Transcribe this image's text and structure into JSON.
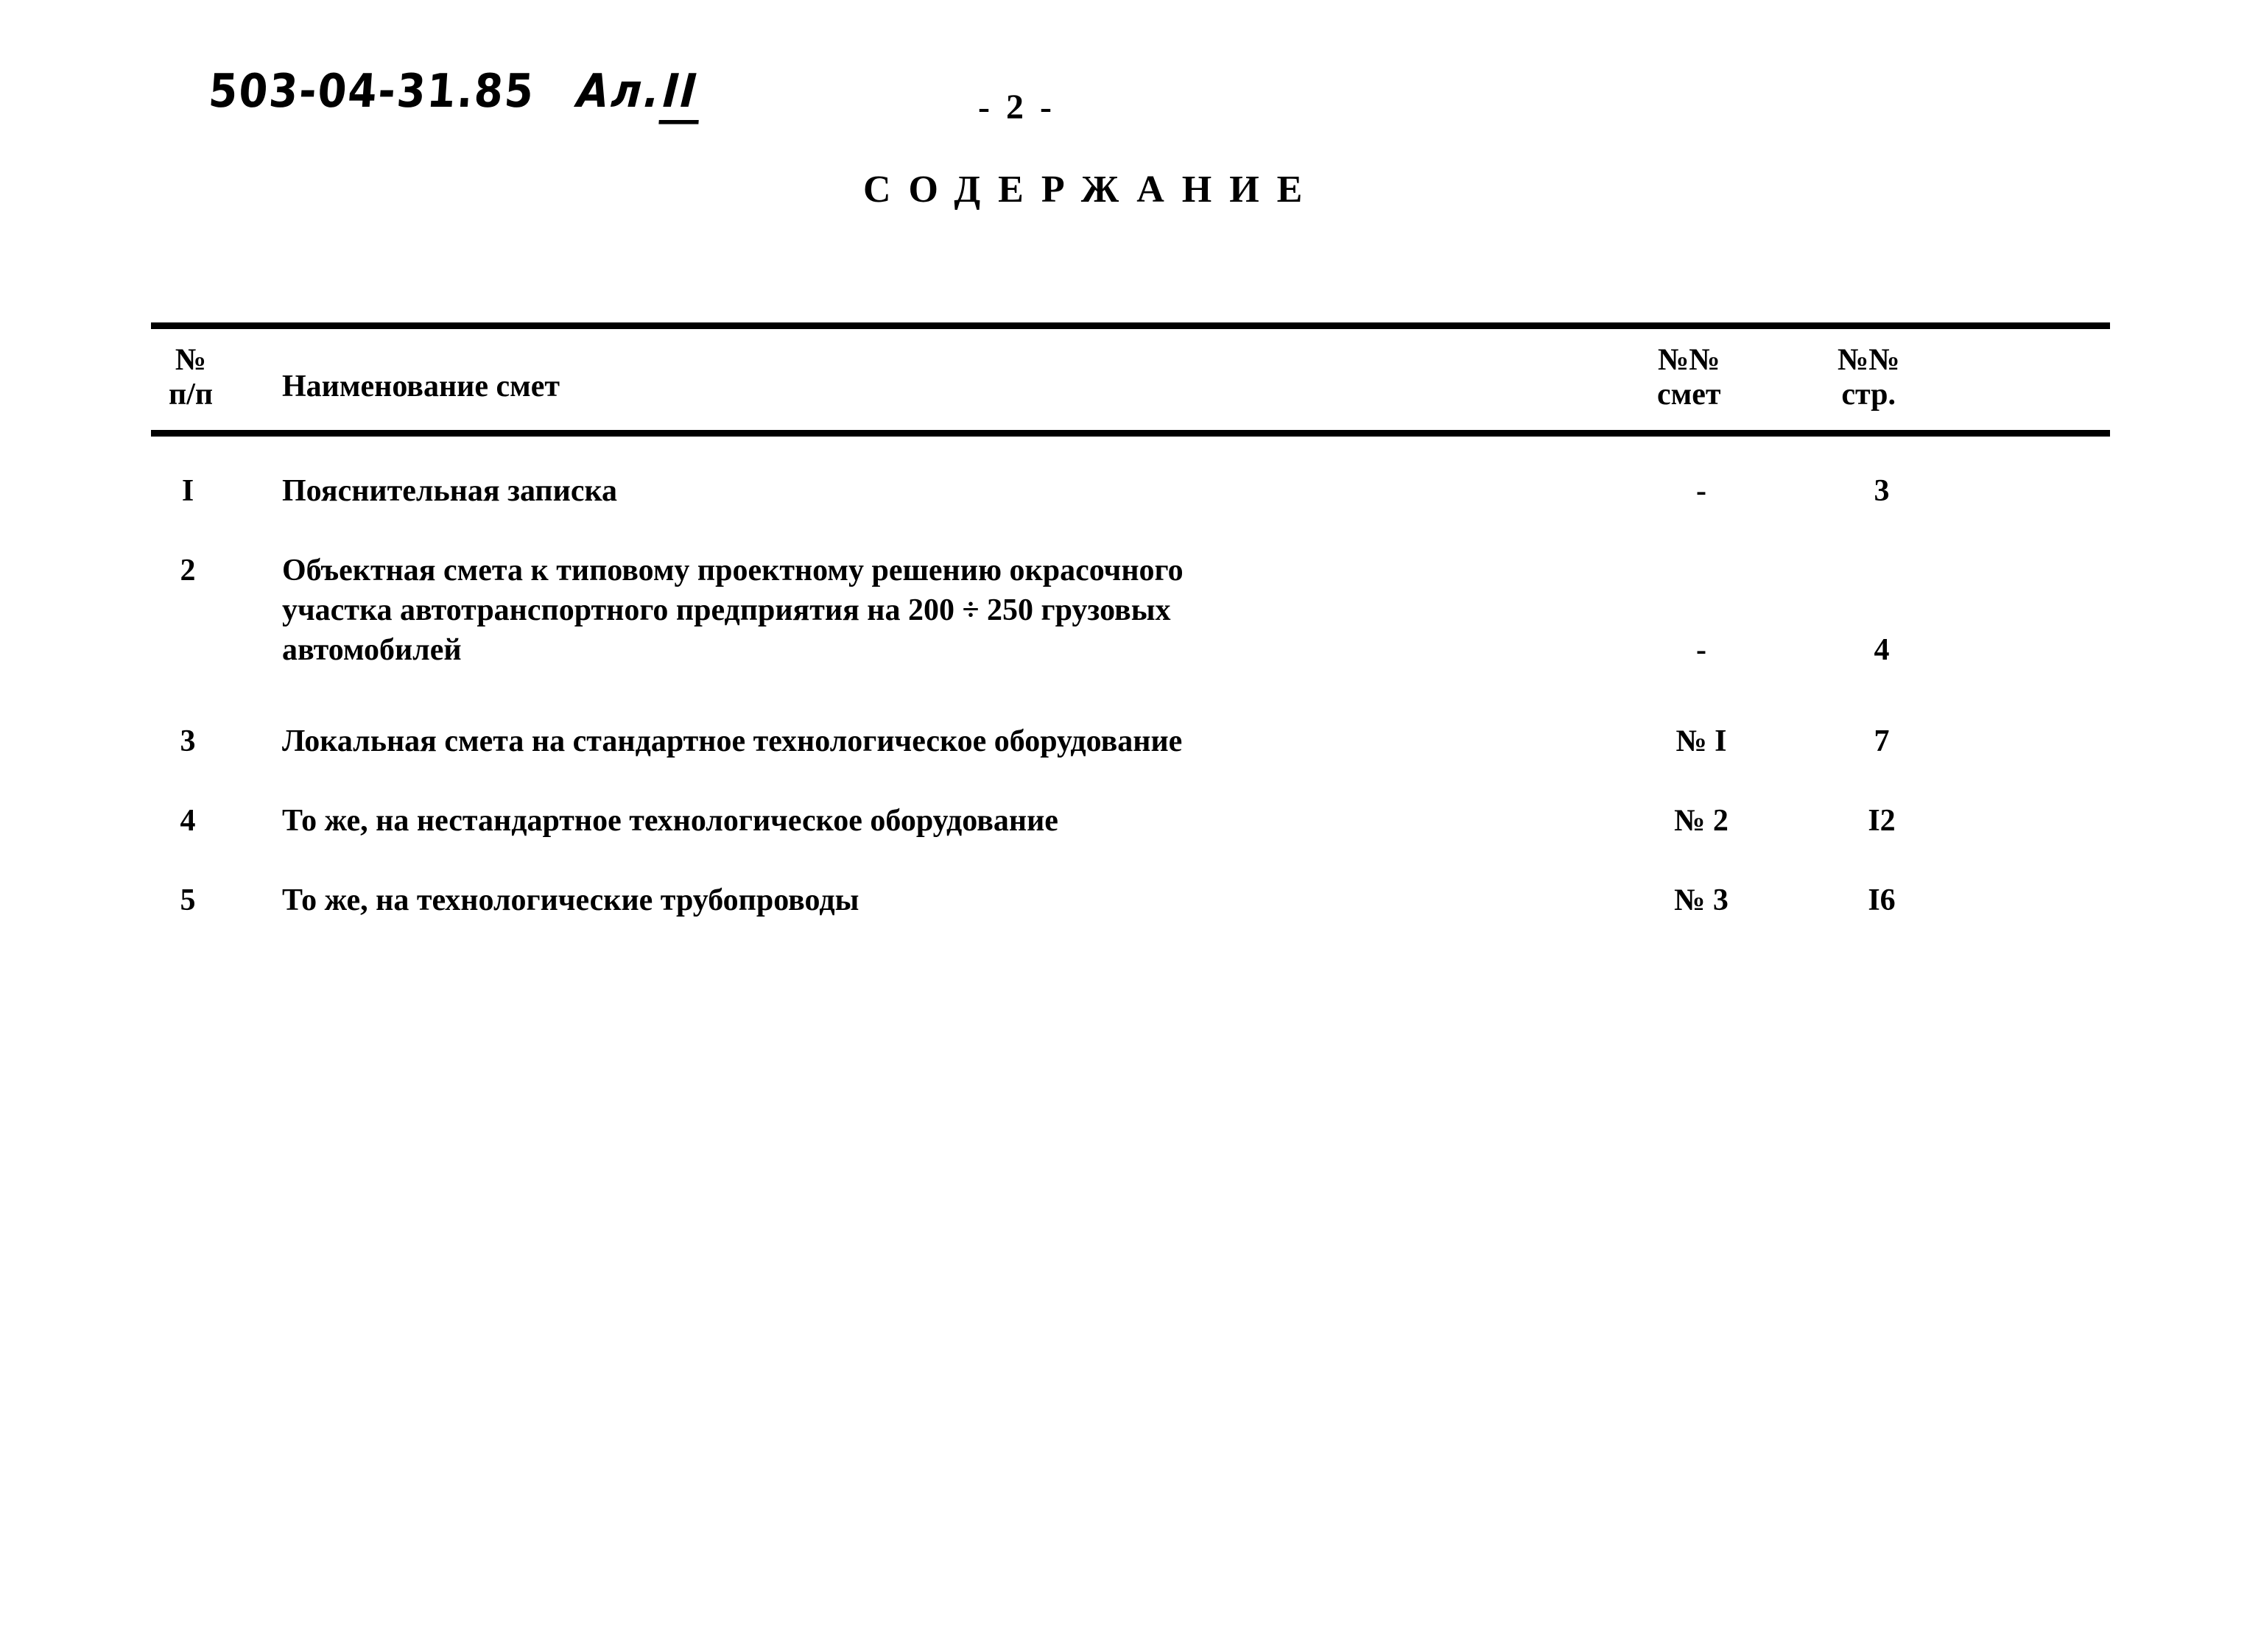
{
  "document": {
    "code": "503-04-31.85",
    "album_label": "Ал.",
    "album_number": "II",
    "page_marker": "- 2 -",
    "heading": "СОДЕРЖАНИЕ"
  },
  "table": {
    "columns": {
      "number": {
        "line1": "№",
        "line2": "п/п"
      },
      "name": {
        "line1": "Наименование смет"
      },
      "estimate_no": {
        "line1": "№№",
        "line2": "смет"
      },
      "page_no": {
        "line1": "№№",
        "line2": "стр."
      }
    },
    "rows": [
      {
        "number": "I",
        "name": "Пояснительная записка",
        "estimate_no": "-",
        "page_no": "3"
      },
      {
        "number": "2",
        "name": "Объектная смета к типовому проектному решению окрасочного\nучастка автотранспортного предприятия на 200 ÷ 250 грузовых\nавтомобилей",
        "estimate_no": "-",
        "page_no": "4"
      },
      {
        "number": "3",
        "name": "Локальная смета на стандартное технологическое оборудование",
        "estimate_no": "№ I",
        "page_no": "7"
      },
      {
        "number": "4",
        "name": "То же, на нестандартное технологическое оборудование",
        "estimate_no": "№ 2",
        "page_no": "I2"
      },
      {
        "number": "5",
        "name": "То же, на технологические трубопроводы",
        "estimate_no": "№ 3",
        "page_no": "I6"
      }
    ]
  }
}
